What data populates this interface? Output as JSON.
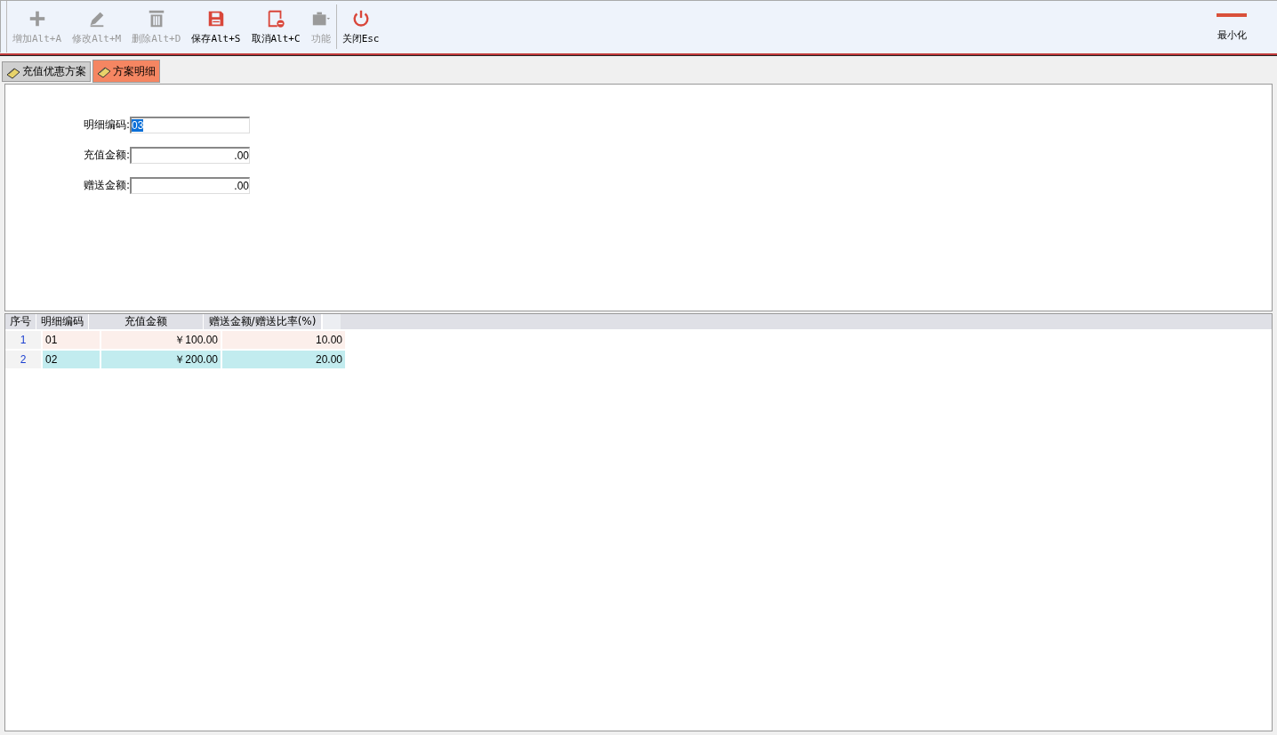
{
  "toolbar": {
    "buttons": [
      {
        "kind": "add",
        "label": "增加Alt+A",
        "disabled": true
      },
      {
        "kind": "edit",
        "label": "修改Alt+M",
        "disabled": true
      },
      {
        "kind": "delete",
        "label": "删除Alt+D",
        "disabled": true
      },
      {
        "kind": "save",
        "label": "保存Alt+S",
        "disabled": false
      },
      {
        "kind": "cancel",
        "label": "取消Alt+C",
        "disabled": false
      },
      {
        "kind": "function",
        "label": "功能",
        "disabled": true
      },
      {
        "kind": "close",
        "label": "关闭Esc",
        "disabled": false
      }
    ],
    "minimize": {
      "label": "最小化"
    }
  },
  "tabs": [
    {
      "label": "充值优惠方案",
      "selected": false
    },
    {
      "label": "方案明细",
      "selected": true
    }
  ],
  "form": {
    "fields": [
      {
        "label": "明细编码:",
        "value": "03",
        "kind": "code",
        "selected": true
      },
      {
        "label": "充值金额:",
        "value": ".00",
        "kind": "amount",
        "selected": false
      },
      {
        "label": "赠送金额:",
        "value": ".00",
        "kind": "amount",
        "selected": false
      }
    ]
  },
  "table": {
    "columns": [
      "序号",
      "明细编码",
      "充值金额",
      "赠送金额/赠送比率(%)"
    ],
    "rows": [
      {
        "cells": [
          "1",
          "01",
          "￥100.00",
          "10.00"
        ],
        "selected": false
      },
      {
        "cells": [
          "2",
          "02",
          "￥200.00",
          "20.00"
        ],
        "selected": true
      }
    ]
  }
}
